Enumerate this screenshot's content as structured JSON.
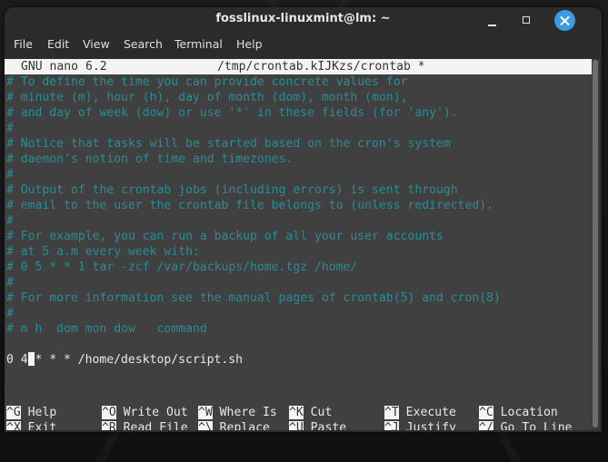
{
  "window": {
    "title": "fosslinux-linuxmint@lm: ~",
    "controls": {
      "minimize": "minimize",
      "maximize": "maximize",
      "close": "close"
    }
  },
  "menubar": [
    "File",
    "Edit",
    "View",
    "Search",
    "Terminal",
    "Help"
  ],
  "nano": {
    "version": "GNU nano 6.2",
    "file_path": "/tmp/crontab.kIJKzs/crontab *",
    "lines": [
      "# To define the time you can provide concrete values for",
      "# minute (m), hour (h), day of month (dom), month (mon),",
      "# and day of week (dow) or use '*' in these fields (for 'any').",
      "#",
      "# Notice that tasks will be started based on the cron's system",
      "# daemon's notion of time and timezones.",
      "#",
      "# Output of the crontab jobs (including errors) is sent through",
      "# email to the user the crontab file belongs to (unless redirected).",
      "#",
      "# For example, you can run a backup of all your user accounts",
      "# at 5 a.m every week with:",
      "# 0 5 * * 1 tar -zcf /var/backups/home.tgz /home/",
      "#",
      "# For more information see the manual pages of crontab(5) and cron(8)",
      "#",
      "# m h  dom mon dow   command",
      ""
    ],
    "cron_entry_before_cursor": "0 4",
    "cron_entry_after_cursor": "* * * /home/desktop/script.sh",
    "shortcuts": [
      {
        "key": "^G",
        "label": "Help"
      },
      {
        "key": "^X",
        "label": "Exit"
      },
      {
        "key": "^O",
        "label": "Write Out"
      },
      {
        "key": "^R",
        "label": "Read File"
      },
      {
        "key": "^W",
        "label": "Where Is"
      },
      {
        "key": "^\\",
        "label": "Replace"
      },
      {
        "key": "^K",
        "label": "Cut"
      },
      {
        "key": "^U",
        "label": "Paste"
      },
      {
        "key": "^T",
        "label": "Execute"
      },
      {
        "key": "^J",
        "label": "Justify"
      },
      {
        "key": "^C",
        "label": "Location"
      },
      {
        "key": "^/",
        "label": "Go To Line"
      }
    ]
  }
}
